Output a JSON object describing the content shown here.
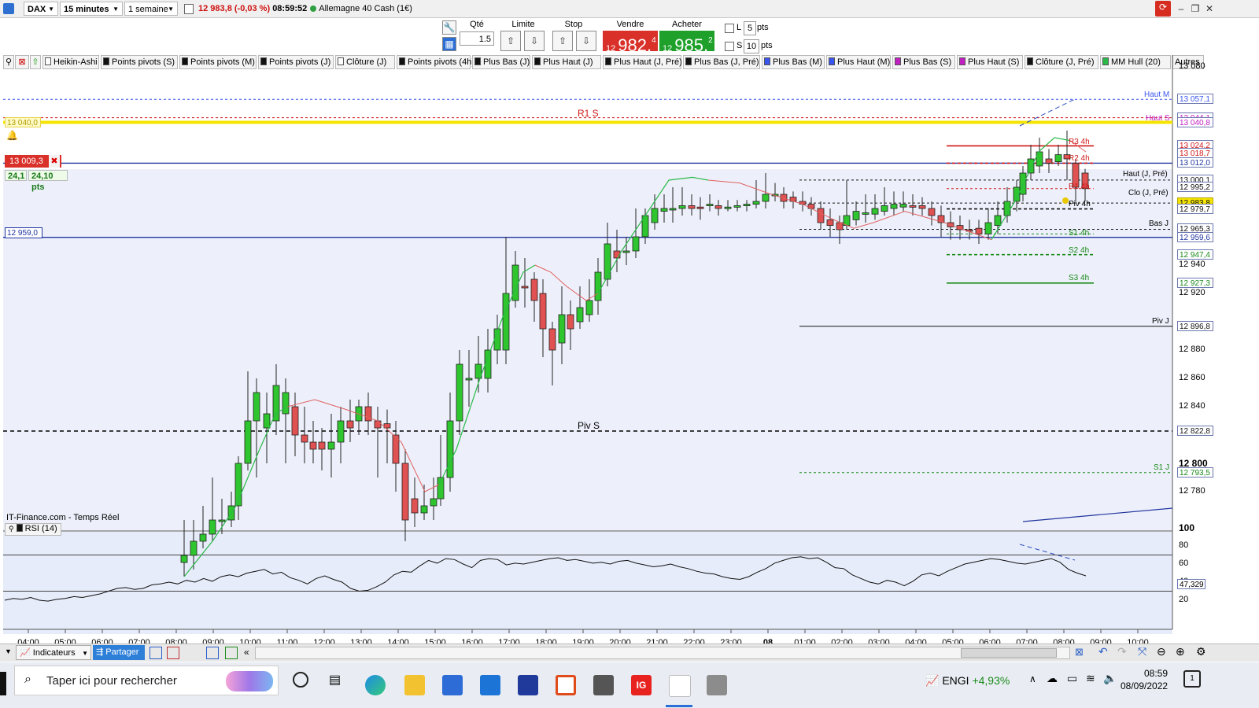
{
  "toolbar": {
    "instrument": "DAX",
    "timeframe": "15 minutes",
    "period": "1 semaine",
    "last_price": "12 983,8 (-0,03 %)",
    "time": "08:59:52",
    "market": "Allemagne 40 Cash (1€)"
  },
  "order": {
    "qty_label": "Qté",
    "qty_value": "1.5",
    "limit_label": "Limite",
    "stop_label": "Stop",
    "sell_label": "Vendre",
    "sell_prefix": "12",
    "sell_big": "982,",
    "sell_small": "4",
    "buy_label": "Acheter",
    "buy_prefix": "12",
    "buy_big": "985,",
    "buy_small": "2",
    "l_label": "L",
    "l_value": "5",
    "s_label": "S",
    "s_value": "10",
    "pts": "pts"
  },
  "indicators": [
    {
      "label": "Heikin-Ashi",
      "color": "#ffffff"
    },
    {
      "label": "Points pivots (S)",
      "color": "#111111"
    },
    {
      "label": "Points pivots (M)",
      "color": "#111111"
    },
    {
      "label": "Points pivots (J)",
      "color": "#111111"
    },
    {
      "label": "Clôture (J)",
      "color": "#ffffff"
    },
    {
      "label": "Points pivots (4h)",
      "color": "#111111"
    },
    {
      "label": "Plus Bas (J)",
      "color": "#111111"
    },
    {
      "label": "Plus Haut (J)",
      "color": "#111111"
    },
    {
      "label": "Plus Haut (J, Pré)",
      "color": "#111111"
    },
    {
      "label": "Plus Bas (J, Pré)",
      "color": "#111111"
    },
    {
      "label": "Plus Bas (M)",
      "color": "#3a55ee"
    },
    {
      "label": "Plus Haut (M)",
      "color": "#3a55ee"
    },
    {
      "label": "Plus Bas (S)",
      "color": "#c020c0"
    },
    {
      "label": "Plus Haut (S)",
      "color": "#c020c0"
    },
    {
      "label": "Clôture (J, Pré)",
      "color": "#111111"
    },
    {
      "label": "MM Hull (20)",
      "color": "#2bb94a"
    },
    {
      "label": "Autres",
      "color": ""
    }
  ],
  "chart": {
    "price_box": "13 009,3",
    "spread_a": "24,1",
    "spread_b": "24,10 pts",
    "left_tag_1": "13 040,0",
    "left_tag_2": "12 959,0",
    "source": "IT-Finance.com - Temps Réel",
    "rsi_label": "RSI (14)",
    "rsi_value": "47,329",
    "y_axis": [
      "13 080",
      "12 940",
      "12 920",
      "12 880",
      "12 860",
      "12 840",
      "12 800",
      "12 780"
    ],
    "y_boxes": [
      "13 057,1",
      "13 044,1",
      "13 040,8",
      "13 024,2",
      "13 018,7",
      "13 012,0",
      "13 000,1",
      "12 995,2",
      "12 983,8",
      "12 979,7",
      "12 965,3",
      "12 959,6",
      "12 947,4",
      "12 927,3",
      "12 896,8",
      "12 822,8",
      "12 793,5"
    ],
    "rsi_axis": [
      "100",
      "80",
      "60",
      "40",
      "20"
    ],
    "x_axis": [
      "04:00",
      "05:00",
      "06:00",
      "07:00",
      "08:00",
      "09:00",
      "10:00",
      "11:00",
      "12:00",
      "13:00",
      "14:00",
      "15:00",
      "16:00",
      "17:00",
      "18:00",
      "19:00",
      "20:00",
      "21:00",
      "22:00",
      "23:00",
      "08",
      "01:00",
      "02:00",
      "03:00",
      "04:00",
      "05:00",
      "06:00",
      "07:00",
      "08:00",
      "09:00",
      "10:00"
    ],
    "levels": {
      "r1s": "R1 S",
      "pivs": "Piv S",
      "haut_m": "Haut M",
      "haut_s": "Haut S",
      "r3_4h": "R3 4h",
      "r2_4h": "R2 4h",
      "r1_4h": "R1 4h",
      "piv_4h": "Piv 4h",
      "s1_4h": "S1 4h",
      "s2_4h": "S2 4h",
      "s3_4h": "S3 4h",
      "haut_j_pre": "Haut (J, Pré)",
      "clo_j_pre": "Clo (J, Pré)",
      "bas_j": "Bas J",
      "piv_j": "Piv J",
      "s1_j": "S1 J"
    },
    "colors": {
      "up": "#2ec52e",
      "down": "#e05252",
      "hull_up": "#2bb94a",
      "hull_down": "#e06060",
      "blue": "#2034a0",
      "yellow": "#f5e400"
    }
  },
  "bottom": {
    "indicators_btn": "Indicateurs",
    "share_btn": "Partager"
  },
  "taskbar": {
    "search_placeholder": "Taper ici pour rechercher",
    "stock": "ENGI",
    "stock_change": "+4,93%",
    "time": "08:59",
    "date": "08/09/2022"
  }
}
